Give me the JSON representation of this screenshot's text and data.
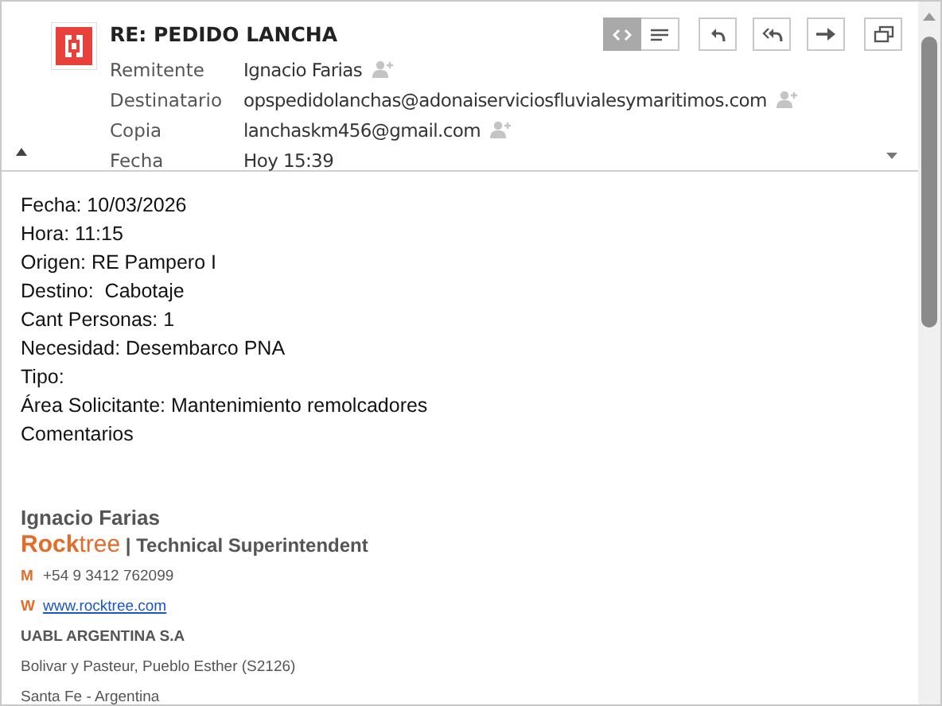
{
  "message": {
    "subject": "RE: PEDIDO LANCHA",
    "fields": [
      {
        "label": "Remitente",
        "value": "Ignacio Farias",
        "add_contact": true
      },
      {
        "label": "Destinatario",
        "value": "opspedidolanchas@adonaiserviciosfluvialesymaritimos.com",
        "add_contact": true
      },
      {
        "label": "Copia",
        "value": "lanchaskm456@gmail.com",
        "add_contact": true
      },
      {
        "label": "Fecha",
        "value": "Hoy 15:39",
        "add_contact": false
      }
    ],
    "header_expanded": true
  },
  "toolbar": {
    "view_toggle": [
      {
        "kind": "source",
        "selected": true
      },
      {
        "kind": "text",
        "selected": false
      }
    ],
    "actions": [
      {
        "kind": "reply"
      },
      {
        "kind": "reply_all"
      },
      {
        "kind": "forward"
      },
      {
        "kind": "popout"
      }
    ]
  },
  "body": {
    "lines": [
      "Fecha: 10/03/2026",
      "Hora: 11:15",
      "Origen: RE Pampero I",
      "Destino:  Cabotaje",
      "Cant Personas: 1",
      "Necesidad: Desembarco PNA",
      "Tipo:",
      "Área Solicitante: Mantenimiento remolcadores",
      "Comentarios"
    ]
  },
  "signature": {
    "name": "Ignacio Farias",
    "brand_strong": "Rock",
    "brand_light": "tree",
    "role": "| Technical Superintendent",
    "contacts": [
      {
        "label": "M",
        "value": "+54 9 3412 762099",
        "kind": "text"
      },
      {
        "label": "W",
        "value": "www.rocktree.com",
        "kind": "link"
      }
    ],
    "company": "UABL ARGENTINA S.A",
    "address": [
      "Bolivar y Pasteur, Pueblo Esther (S2126)",
      "Santa Fe - Argentina"
    ]
  }
}
